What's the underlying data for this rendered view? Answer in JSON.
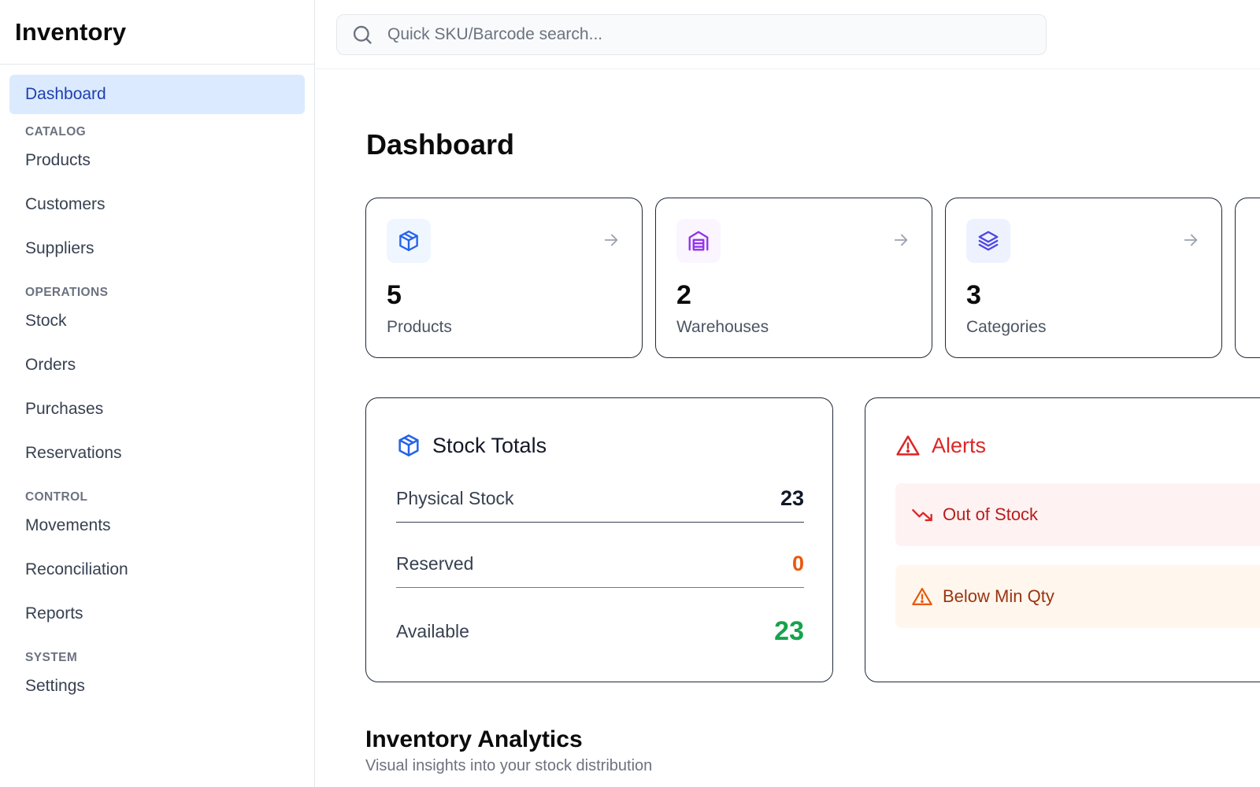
{
  "app": {
    "title": "Inventory"
  },
  "search": {
    "placeholder": "Quick SKU/Barcode search..."
  },
  "sidebar": {
    "dashboard": "Dashboard",
    "sections": {
      "catalog": "CATALOG",
      "operations": "OPERATIONS",
      "control": "CONTROL",
      "system": "SYSTEM"
    },
    "items": {
      "products": "Products",
      "customers": "Customers",
      "suppliers": "Suppliers",
      "stock": "Stock",
      "orders": "Orders",
      "purchases": "Purchases",
      "reservations": "Reservations",
      "movements": "Movements",
      "reconciliation": "Reconciliation",
      "reports": "Reports",
      "settings": "Settings"
    }
  },
  "main": {
    "title": "Dashboard",
    "cards": [
      {
        "value": "5",
        "label": "Products",
        "icon": "box-icon",
        "color": "#2563eb",
        "bg": "#eff6ff"
      },
      {
        "value": "2",
        "label": "Warehouses",
        "icon": "warehouse-icon",
        "color": "#9333ea",
        "bg": "#faf5ff"
      },
      {
        "value": "3",
        "label": "Categories",
        "icon": "layers-icon",
        "color": "#4f46e5",
        "bg": "#eef2ff"
      }
    ],
    "stock_totals": {
      "title": "Stock Totals",
      "rows": [
        {
          "label": "Physical Stock",
          "value": "23",
          "color": "#111827",
          "divider": "#374151"
        },
        {
          "label": "Reserved",
          "value": "0",
          "color": "#ea580c",
          "divider": "#ef4444"
        },
        {
          "label": "Available",
          "value": "23",
          "color": "#16a34a"
        }
      ]
    },
    "alerts": {
      "title": "Alerts",
      "items": [
        {
          "label": "Out of Stock",
          "icon": "trending-down-icon",
          "color": "#b91c1c",
          "bg": "#fef2f2"
        },
        {
          "label": "Below Min Qty",
          "icon": "warning-icon",
          "color": "#9a3412",
          "bg": "#fff7ed"
        }
      ]
    },
    "analytics": {
      "title": "Inventory Analytics",
      "subtitle": "Visual insights into your stock distribution"
    }
  },
  "colors": {
    "active_bg": "#dbeafe",
    "active_text": "#1e40af",
    "alert_red": "#dc2626"
  }
}
